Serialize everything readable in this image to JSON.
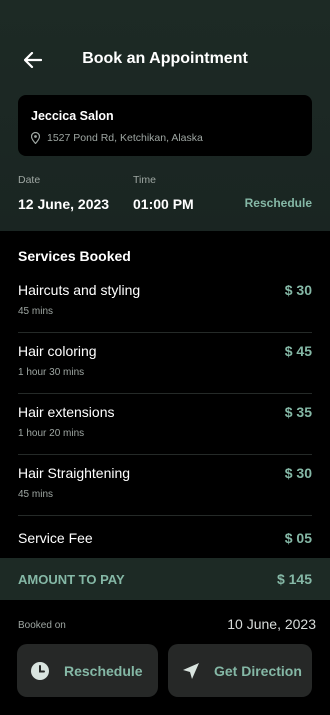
{
  "header": {
    "title": "Book an Appointment",
    "back_icon": "arrow-left-icon"
  },
  "salon": {
    "name": "Jeccica Salon",
    "address": "1527 Pond Rd, Ketchikan, Alaska",
    "address_icon": "location-pin-icon"
  },
  "appointment": {
    "date_label": "Date",
    "date_value": "12 June, 2023",
    "time_label": "Time",
    "time_value": "01:00 PM",
    "reschedule_link": "Reschedule"
  },
  "services": {
    "title": "Services Booked",
    "items": [
      {
        "name": "Haircuts and styling",
        "duration": "45 mins",
        "price": "$ 30"
      },
      {
        "name": "Hair coloring",
        "duration": "1 hour 30 mins",
        "price": "$ 45"
      },
      {
        "name": "Hair extensions",
        "duration": "1 hour 20 mins",
        "price": "$ 35"
      },
      {
        "name": "Hair Straightening",
        "duration": "45 mins",
        "price": "$ 30"
      }
    ],
    "fee": {
      "name": "Service Fee",
      "price": "$ 05"
    }
  },
  "total": {
    "label": "AMOUNT TO PAY",
    "value": "$ 145"
  },
  "booking": {
    "label": "Booked on",
    "value": "10 June, 2023"
  },
  "actions": {
    "reschedule": {
      "label": "Reschedule",
      "icon": "clock-icon"
    },
    "direction": {
      "label": "Get Direction",
      "icon": "navigation-arrow-icon"
    }
  },
  "colors": {
    "accent": "#85b8a6",
    "header_bg": "#1d2a25",
    "card_bg": "#262827",
    "page_bg": "#000000"
  }
}
